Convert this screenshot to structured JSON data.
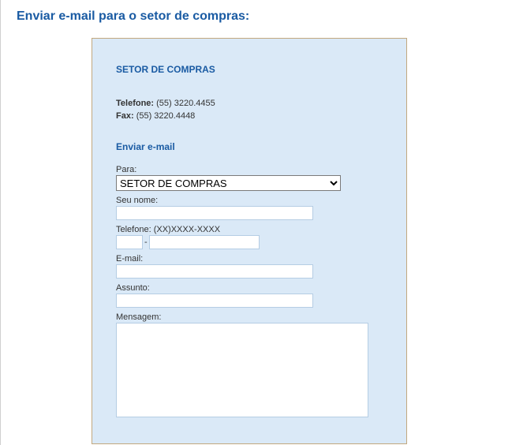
{
  "page": {
    "title": "Enviar e-mail para o setor de compras:"
  },
  "card": {
    "section_header": "SETOR DE COMPRAS",
    "telefone_label": "Telefone:",
    "telefone_value": "(55) 3220.4455",
    "fax_label": "Fax:",
    "fax_value": "(55) 3220.4448",
    "subheader": "Enviar e-mail"
  },
  "form": {
    "para_label": "Para:",
    "para_selected": "SETOR DE COMPRAS",
    "nome_label": "Seu nome:",
    "nome_value": "",
    "telefone_label": "Telefone: (XX)XXXX-XXXX",
    "telefone_ddd_value": "",
    "telefone_num_value": "",
    "telefone_dash": "-",
    "email_label": "E-mail:",
    "email_value": "",
    "assunto_label": "Assunto:",
    "assunto_value": "",
    "mensagem_label": "Mensagem:",
    "mensagem_value": ""
  }
}
